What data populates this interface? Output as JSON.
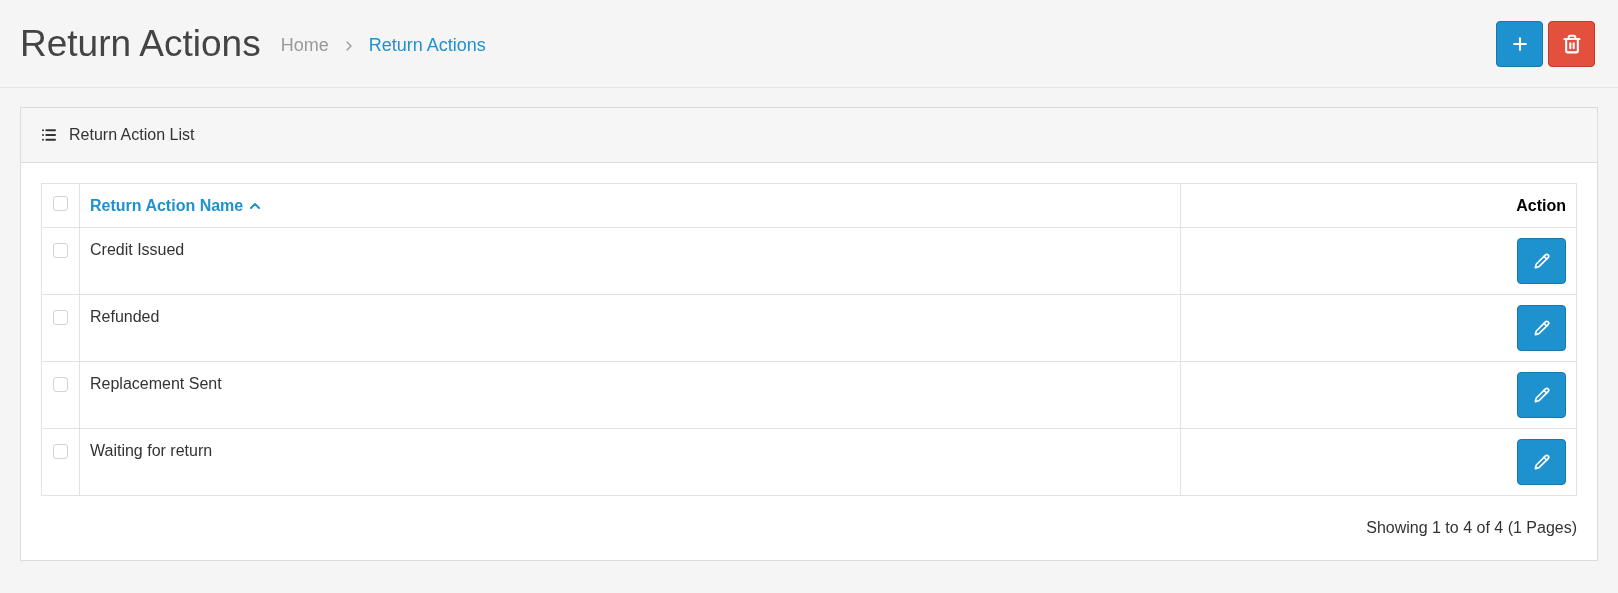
{
  "page": {
    "title": "Return Actions"
  },
  "breadcrumb": [
    {
      "label": "Home",
      "selected": false
    },
    {
      "label": "Return Actions",
      "selected": true
    }
  ],
  "panel": {
    "title": "Return Action List"
  },
  "table": {
    "select_all_checked": false,
    "columns": [
      {
        "label": "Return Action Name",
        "sorted": true
      },
      {
        "label": "Action",
        "sorted": false
      }
    ],
    "rows": [
      {
        "name": "Credit Issued",
        "checked": false
      },
      {
        "name": "Refunded",
        "checked": false
      },
      {
        "name": "Replacement Sent",
        "checked": false
      },
      {
        "name": "Waiting for return",
        "checked": false
      }
    ]
  },
  "pagination": "Showing 1 to 4 of 4 (1 Pages)"
}
